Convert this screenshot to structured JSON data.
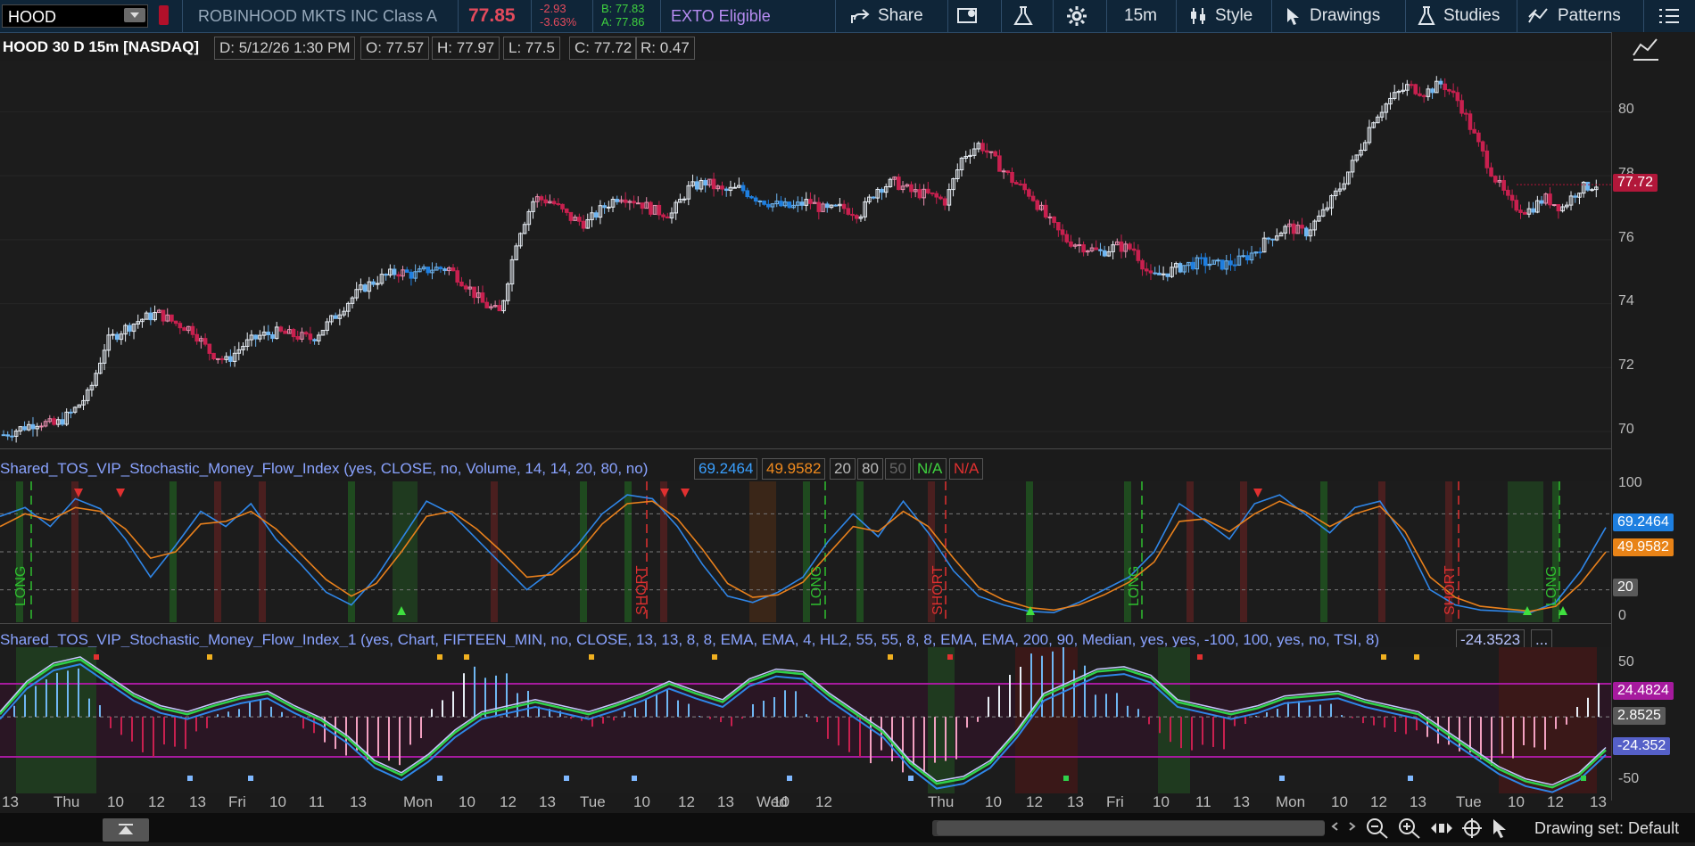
{
  "toolbar": {
    "symbol": "HOOD",
    "company": "ROBINHOOD MKTS INC Class A",
    "last": "77.85",
    "change": "-2.93",
    "change_pct": "-3.63%",
    "bid": "B: 77.83",
    "ask": "A: 77.86",
    "exto": "EXTO Eligible",
    "share_label": "Share",
    "timeframe": "15m",
    "style_label": "Style",
    "drawings_label": "Drawings",
    "studies_label": "Studies",
    "patterns_label": "Patterns",
    "colors": {
      "bg": "#0f2538",
      "last": "#e24a5c",
      "bid_ask": "#3fd13f",
      "exto": "#b78cf2"
    }
  },
  "header": {
    "symbol_line": "HOOD 30 D 15m [NASDAQ]",
    "date": "D: 5/12/26 1:30 PM",
    "open": "O: 77.57",
    "high": "H: 77.97",
    "low": "L: 77.5",
    "close": "C: 77.72",
    "range": "R: 0.47"
  },
  "price_axis": {
    "ticks": [
      "80",
      "78",
      "76",
      "74",
      "72",
      "70"
    ],
    "tick_values": [
      80,
      78,
      76,
      74,
      72,
      70
    ],
    "range": [
      69.5,
      81.6
    ],
    "current_tag": "77.72"
  },
  "study1": {
    "label": "Shared_TOS_VIP_Stochastic_Money_Flow_Index (yes, CLOSE, no, Volume, 14, 14, 20, 80, no)",
    "v1": "69.2464",
    "v2": "49.9582",
    "v3": "20",
    "v4": "80",
    "v5": "50",
    "v6": "N/A",
    "v7": "N/A",
    "ticks": [
      "100",
      "20",
      "0"
    ],
    "tag_blue": "69.2464",
    "tag_orange": "49.9582",
    "tag_gray": "20",
    "signals": [
      "LONG",
      "SHORT",
      "LONG",
      "SHORT",
      "LONG",
      "SHORT",
      "LONG"
    ]
  },
  "study2": {
    "label": "Shared_TOS_VIP_Stochastic_Money_Flow_Index_1 (yes, Chart, FIFTEEN_MIN, no, CLOSE, 13, 13, 8, 8, EMA, EMA, 4, HL2, 55, 55, 8, 8, EMA, EMA, 200, 90, Median, yes, yes, -100, 100, yes, no, TSI, 8)",
    "value": "-24.3523",
    "more": "...",
    "ticks": [
      "50",
      "-50"
    ],
    "tag_magenta": "24.4824",
    "tag_gray": "2.8525",
    "tag_blue": "-24.352"
  },
  "time_axis": {
    "labels": [
      "13",
      "Thu",
      "10",
      "12",
      "13",
      "Fri",
      "10",
      "11",
      "13",
      "Mon",
      "10",
      "12",
      "13",
      "Tue",
      "10",
      "12",
      "13",
      "Wed",
      "10",
      "12",
      "Thu",
      "10",
      "12",
      "13",
      "Fri",
      "10",
      "11",
      "13",
      "Mon",
      "10",
      "12",
      "13",
      "Tue",
      "10",
      "12",
      "13"
    ]
  },
  "bottom": {
    "drawing_set": "Drawing set: Default"
  },
  "chart_data": [
    {
      "type": "candlestick",
      "title": "HOOD 30 D 15m [NASDAQ]",
      "ylim": [
        69.5,
        81.6
      ],
      "yticks": [
        70,
        72,
        74,
        76,
        78,
        80
      ],
      "close_path": [
        69.9,
        70.1,
        70.3,
        70.2,
        70.6,
        71.2,
        72.8,
        73.2,
        73.5,
        73.7,
        73.4,
        73.2,
        72.5,
        72.2,
        72.7,
        73.0,
        73.1,
        73.0,
        72.9,
        73.4,
        74.0,
        74.5,
        74.8,
        75.0,
        74.9,
        75.1,
        75.1,
        74.6,
        74.0,
        73.7,
        76.1,
        77.3,
        77.2,
        76.7,
        76.5,
        77.0,
        77.4,
        77.2,
        76.9,
        76.8,
        77.6,
        77.8,
        77.5,
        77.6,
        77.3,
        77.1,
        77.0,
        77.2,
        76.9,
        77.0,
        76.8,
        77.6,
        77.8,
        77.5,
        77.4,
        77.2,
        78.6,
        79.0,
        78.4,
        77.8,
        77.4,
        76.6,
        76.0,
        75.8,
        75.6,
        75.8,
        75.7,
        74.8,
        75.0,
        75.2,
        75.3,
        75.2,
        75.3,
        75.6,
        76.1,
        76.4,
        76.2,
        76.8,
        77.6,
        78.6,
        79.8,
        80.4,
        80.8,
        80.6,
        80.9,
        80.3,
        79.1,
        78.0,
        77.1,
        76.9,
        77.3,
        77.0,
        77.6,
        77.72
      ],
      "last": 77.72
    },
    {
      "type": "line",
      "title": "Shared_TOS_VIP_Stochastic_Money_Flow_Index",
      "ylim": [
        0,
        100
      ],
      "levels": [
        20,
        50,
        80
      ],
      "series": [
        {
          "name": "69.2464",
          "values": [
            78,
            85,
            70,
            92,
            84,
            60,
            30,
            55,
            82,
            70,
            88,
            60,
            40,
            18,
            8,
            30,
            60,
            90,
            80,
            60,
            40,
            20,
            35,
            55,
            80,
            95,
            92,
            70,
            40,
            15,
            10,
            18,
            30,
            58,
            80,
            62,
            90,
            65,
            35,
            15,
            8,
            3,
            2,
            10,
            20,
            30,
            50,
            88,
            75,
            60,
            88,
            95,
            80,
            65,
            85,
            90,
            60,
            20,
            8,
            4,
            3,
            2,
            10,
            35,
            69.2464
          ]
        },
        {
          "name": "49.9582",
          "values": [
            70,
            80,
            75,
            85,
            82,
            68,
            45,
            50,
            72,
            74,
            82,
            68,
            48,
            28,
            15,
            25,
            50,
            78,
            82,
            68,
            50,
            30,
            32,
            48,
            72,
            88,
            90,
            76,
            52,
            25,
            14,
            16,
            26,
            48,
            70,
            66,
            82,
            70,
            45,
            22,
            12,
            6,
            4,
            8,
            16,
            26,
            42,
            74,
            76,
            66,
            80,
            90,
            82,
            70,
            80,
            86,
            66,
            30,
            14,
            7,
            5,
            3,
            7,
            25,
            49.9582
          ]
        }
      ]
    },
    {
      "type": "line",
      "title": "Shared_TOS_VIP_Stochastic_Money_Flow_Index_1",
      "ylim": [
        -60,
        60
      ],
      "levels": [
        50,
        -50
      ],
      "series": [
        {
          "name": "-24.3523",
          "values": [
            5,
            30,
            45,
            50,
            35,
            20,
            10,
            5,
            12,
            18,
            22,
            10,
            0,
            -15,
            -35,
            -45,
            -30,
            -10,
            5,
            10,
            15,
            10,
            5,
            12,
            20,
            30,
            22,
            15,
            32,
            40,
            38,
            20,
            5,
            -10,
            -35,
            -52,
            -48,
            -35,
            -10,
            20,
            30,
            40,
            42,
            35,
            15,
            10,
            5,
            10,
            18,
            20,
            22,
            15,
            10,
            5,
            -10,
            -25,
            -40,
            -50,
            -55,
            -45,
            -24.3523
          ]
        }
      ]
    }
  ]
}
